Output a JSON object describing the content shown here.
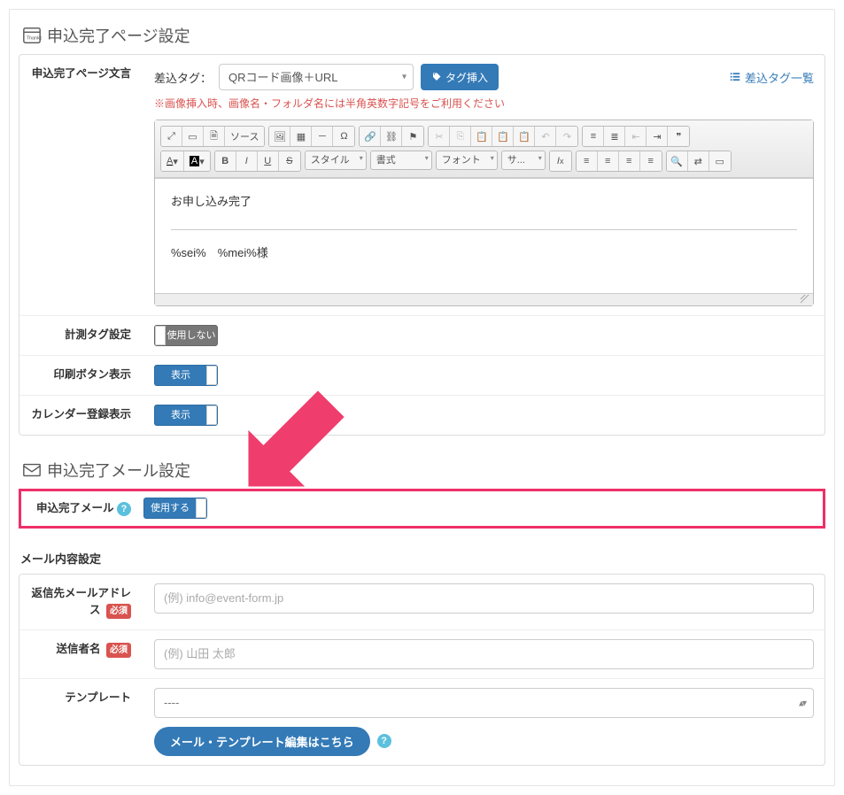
{
  "section1": {
    "title": "申込完了ページ設定"
  },
  "page_text": {
    "label": "申込完了ページ文言",
    "merge_tag_label": "差込タグ：",
    "merge_tag_value": "QRコード画像＋URL",
    "insert_btn": "タグ挿入",
    "tag_list_link": "差込タグ一覧",
    "warning": "※画像挿入時、画像名・フォルダ名には半角英数字記号をご利用ください",
    "editor_source_label": "ソース",
    "style_sel": "スタイル",
    "format_sel": "書式",
    "font_sel": "フォント",
    "size_sel": "サ...",
    "body_line1": "お申し込み完了",
    "body_line2": "%sei%　%mei%様"
  },
  "tracking": {
    "label": "計測タグ設定",
    "toggle": "使用しない",
    "state": "off"
  },
  "print_btn": {
    "label": "印刷ボタン表示",
    "toggle": "表示",
    "state": "on"
  },
  "calendar": {
    "label": "カレンダー登録表示",
    "toggle": "表示",
    "state": "on"
  },
  "section2": {
    "title": "申込完了メール設定"
  },
  "mail_enable": {
    "label": "申込完了メール",
    "toggle": "使用する",
    "state": "on"
  },
  "mail_content_header": "メール内容設定",
  "reply_to": {
    "label": "返信先メールアドレス",
    "req": "必須",
    "placeholder": "(例) info@event-form.jp"
  },
  "sender": {
    "label": "送信者名",
    "req": "必須",
    "placeholder": "(例) 山田 太郎"
  },
  "template": {
    "label": "テンプレート",
    "value": "----",
    "edit_btn": "メール・テンプレート編集はこちら"
  }
}
